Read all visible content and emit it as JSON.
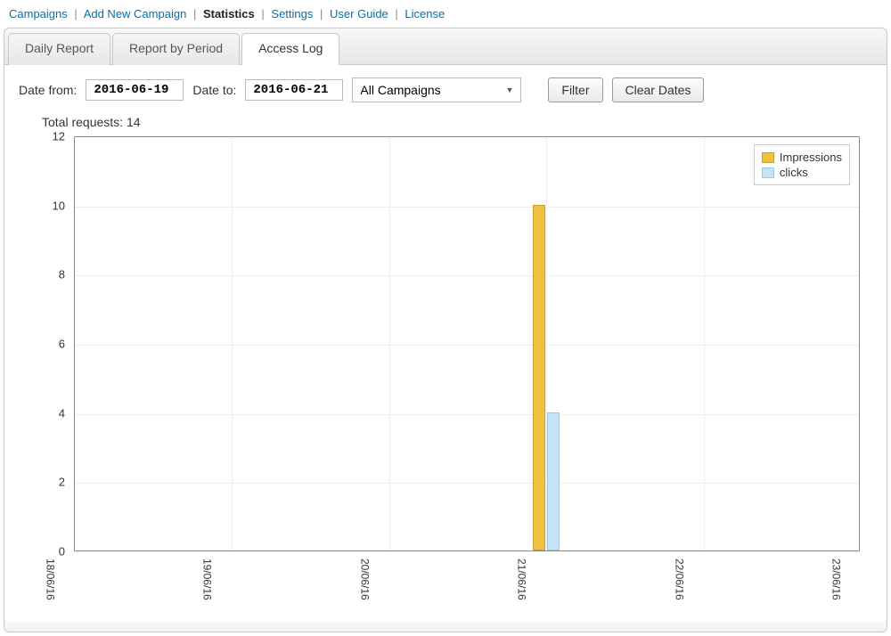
{
  "nav": {
    "items": [
      {
        "label": "Campaigns",
        "active": false
      },
      {
        "label": "Add New Campaign",
        "active": false
      },
      {
        "label": "Statistics",
        "active": true
      },
      {
        "label": "Settings",
        "active": false
      },
      {
        "label": "User Guide",
        "active": false
      },
      {
        "label": "License",
        "active": false
      }
    ]
  },
  "tabs": {
    "items": [
      {
        "label": "Daily Report",
        "active": false
      },
      {
        "label": "Report by Period",
        "active": false
      },
      {
        "label": "Access Log",
        "active": true
      }
    ]
  },
  "filters": {
    "date_from_label": "Date from:",
    "date_from_value": "2016-06-19",
    "date_to_label": "Date to:",
    "date_to_value": "2016-06-21",
    "campaign_selected": "All Campaigns",
    "filter_btn": "Filter",
    "clear_btn": "Clear Dates"
  },
  "summary": {
    "total_requests_label": "Total requests: 14"
  },
  "legend": {
    "impressions": "Impressions",
    "clicks": "clicks"
  },
  "chart_data": {
    "type": "bar",
    "categories": [
      "18/06/16",
      "19/06/16",
      "20/06/16",
      "21/06/16",
      "22/06/16",
      "23/06/16"
    ],
    "series": [
      {
        "name": "Impressions",
        "values": [
          0,
          0,
          0,
          10,
          0,
          0
        ]
      },
      {
        "name": "clicks",
        "values": [
          0,
          0,
          0,
          4,
          0,
          0
        ]
      }
    ],
    "ylim": [
      0,
      12
    ],
    "yticks": [
      0,
      2,
      4,
      6,
      8,
      10,
      12
    ],
    "xlabel": "",
    "ylabel": "",
    "title": "",
    "colors": {
      "Impressions": "#edc240",
      "clicks": "#c6e4f6"
    }
  }
}
